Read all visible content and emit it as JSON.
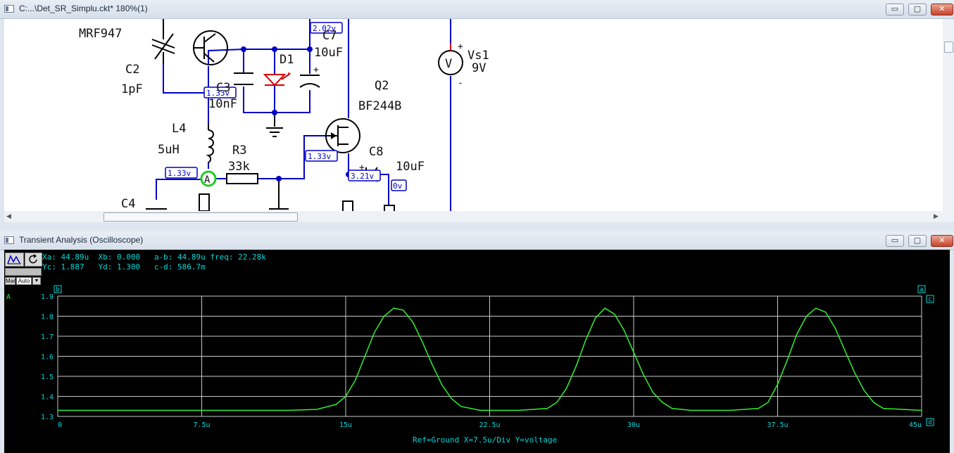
{
  "schematic_window": {
    "title": "C:...\\Det_SR_Simplu.ckt* 180%(1)"
  },
  "scope_window": {
    "title": "Transient Analysis (Oscilloscope)"
  },
  "window_buttons": {
    "minimize": "▭",
    "maximize": "▢",
    "close": "✕"
  },
  "schematic": {
    "labels": {
      "mrf": "MRF947",
      "c2": "C2",
      "c2v": "1pF",
      "l4": "L4",
      "l4v": "5uH",
      "r3": "R3",
      "r3v": "33k",
      "c4": "C4",
      "c3": "C3",
      "c3v": "10nF",
      "d1": "D1",
      "c7": "C7",
      "c7v": "10uF",
      "q2": "Q2",
      "q2v": "BF244B",
      "c8": "C8",
      "c8v": "10uF",
      "vs1": "Vs1",
      "vs1v": "9V",
      "plus": "+",
      "minus": "-",
      "vsym": "V",
      "probe": "A"
    },
    "probes": [
      "2.02v",
      "1.33v",
      "1.33v",
      "1.33v",
      "3.21v",
      "0v"
    ],
    "colors": {
      "wire": "#0000c8",
      "component": "#000000",
      "led": "#d40000",
      "probe_ring": "#22cc22"
    }
  },
  "scope": {
    "toolbar": {
      "man": "Man",
      "auto": "Auto"
    },
    "readout_line1": "Xa: 44.89u  Xb: 0.000   a-b: 44.89u freq: 22.28k",
    "readout_line2": "Yc: 1.887   Yd: 1.300   c-d: 586.7m",
    "trace_name": "A",
    "footer": "Ref=Ground  X=7.5u/Div Y=voltage",
    "cursor_labels": {
      "b": "b",
      "a": "a",
      "c": "c",
      "d": "d"
    },
    "colors": {
      "background": "#000000",
      "grid": "#c8c8c8",
      "text": "#00d8d8",
      "trace": "#33ee33"
    }
  },
  "chart_data": {
    "type": "line",
    "title": "",
    "xlabel": "",
    "ylabel": "",
    "xlim": [
      0,
      45
    ],
    "ylim": [
      1.3,
      1.9
    ],
    "x_unit": "u",
    "x_ticks": [
      "0",
      "7.5u",
      "15u",
      "22.5u",
      "30u",
      "37.5u",
      "45u"
    ],
    "y_ticks": [
      "1.3",
      "1.4",
      "1.5",
      "1.6",
      "1.7",
      "1.8",
      "1.9"
    ],
    "grid": true,
    "series": [
      {
        "name": "A",
        "x": [
          0,
          4,
          8,
          12,
          13.5,
          14.5,
          15,
          15.5,
          16,
          16.5,
          17,
          17.5,
          18,
          18.5,
          19,
          19.5,
          20,
          20.5,
          21,
          22,
          24,
          25.5,
          26,
          26.5,
          27,
          27.5,
          28,
          28.5,
          29,
          29.5,
          30,
          30.5,
          31,
          31.5,
          32,
          33,
          35,
          36.5,
          37,
          37.5,
          38,
          38.5,
          39,
          39.5,
          40,
          40.5,
          41,
          41.5,
          42,
          42.5,
          43,
          45
        ],
        "y": [
          1.33,
          1.33,
          1.33,
          1.33,
          1.335,
          1.36,
          1.4,
          1.48,
          1.6,
          1.72,
          1.8,
          1.84,
          1.83,
          1.77,
          1.67,
          1.56,
          1.46,
          1.39,
          1.35,
          1.33,
          1.33,
          1.34,
          1.37,
          1.44,
          1.55,
          1.68,
          1.79,
          1.84,
          1.81,
          1.73,
          1.62,
          1.51,
          1.42,
          1.37,
          1.34,
          1.33,
          1.33,
          1.34,
          1.37,
          1.46,
          1.58,
          1.71,
          1.8,
          1.84,
          1.82,
          1.74,
          1.63,
          1.52,
          1.43,
          1.37,
          1.34,
          1.33
        ]
      }
    ]
  }
}
